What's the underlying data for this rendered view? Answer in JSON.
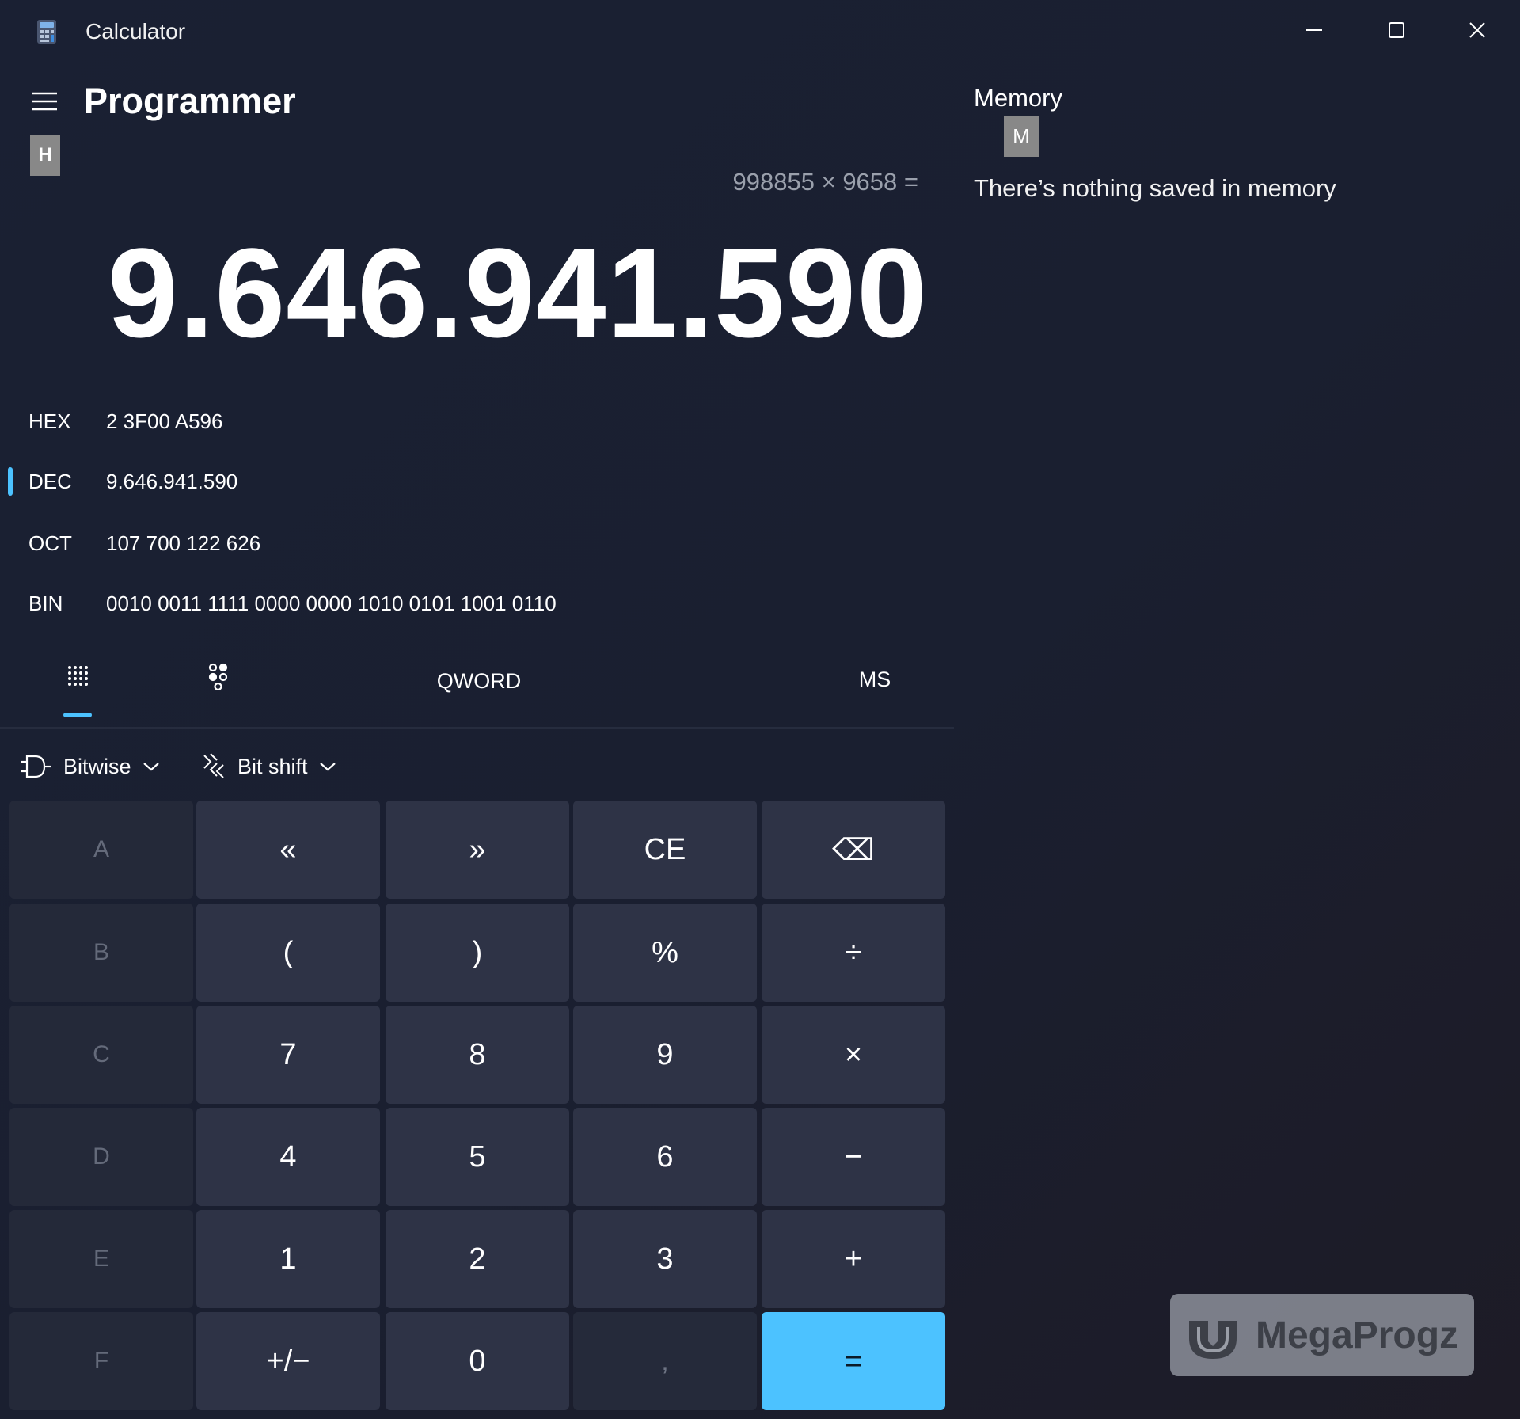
{
  "window": {
    "title": "Calculator",
    "icons": {
      "app": "calculator-icon",
      "minimize": "minimize-icon",
      "maximize": "maximize-icon",
      "close": "close-icon"
    }
  },
  "header": {
    "mode": "Programmer",
    "badge": "H",
    "menu_icon": "hamburger-icon"
  },
  "display": {
    "expression": "998855 × 9658 =",
    "result": "9.646.941.590"
  },
  "radix": [
    {
      "label": "HEX",
      "value": "2 3F00 A596",
      "selected": false
    },
    {
      "label": "DEC",
      "value": "9.646.941.590",
      "selected": true
    },
    {
      "label": "OCT",
      "value": "107 700 122 626",
      "selected": false
    },
    {
      "label": "BIN",
      "value": "0010 0011 1111 0000 0000 1010 0101 1001 0110",
      "selected": false
    }
  ],
  "toolbar": {
    "keypad_icon": "full-keypad-icon",
    "bit_icon": "bit-toggle-keypad-icon",
    "word_size": "QWORD",
    "memory_store": "MS",
    "active_tab": "full-keypad"
  },
  "dropdowns": {
    "bitwise": "Bitwise",
    "bitshift": "Bit shift"
  },
  "keypad": [
    [
      "A",
      "«",
      "»",
      "CE",
      "⌫"
    ],
    [
      "B",
      "(",
      ")",
      "%",
      "÷"
    ],
    [
      "C",
      "7",
      "8",
      "9",
      "×"
    ],
    [
      "D",
      "4",
      "5",
      "6",
      "−"
    ],
    [
      "E",
      "1",
      "2",
      "3",
      "+"
    ],
    [
      "F",
      "+/−",
      "0",
      ",",
      "="
    ]
  ],
  "memory": {
    "title": "Memory",
    "badge": "M",
    "empty_message": "There’s nothing saved in memory"
  },
  "watermark": {
    "text": "MegaProgz"
  },
  "colors": {
    "accent": "#4cc2ff",
    "key": "#2e3346",
    "key_disabled": "#242939",
    "background": "#1a2033"
  }
}
